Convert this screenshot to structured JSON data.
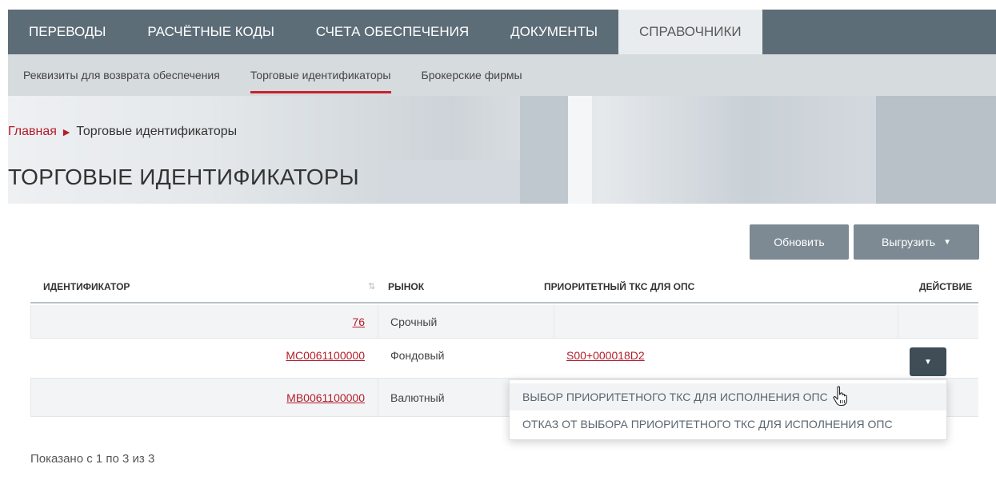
{
  "main_nav": [
    {
      "label": "ПЕРЕВОДЫ"
    },
    {
      "label": "РАСЧЁТНЫЕ КОДЫ"
    },
    {
      "label": "СЧЕТА ОБЕСПЕЧЕНИЯ"
    },
    {
      "label": "ДОКУМЕНТЫ"
    },
    {
      "label": "СПРАВОЧНИКИ",
      "active": true
    }
  ],
  "sub_nav": [
    {
      "label": "Реквизиты для возврата обеспечения"
    },
    {
      "label": "Торговые идентификаторы",
      "active": true
    },
    {
      "label": "Брокерские фирмы"
    }
  ],
  "breadcrumb": {
    "home": "Главная",
    "current": "Торговые идентификаторы"
  },
  "page_title": "ТОРГОВЫЕ ИДЕНТИФИКАТОРЫ",
  "toolbar": {
    "refresh_label": "Обновить",
    "export_label": "Выгрузить"
  },
  "table": {
    "headers": [
      "ИДЕНТИФИКАТОР",
      "РЫНОК",
      "ПРИОРИТЕТНЫЙ ТКС ДЛЯ ОПС",
      "ДЕЙСТВИЕ"
    ],
    "rows": [
      {
        "id": "76",
        "market": "Срочный",
        "tks": ""
      },
      {
        "id": "MC0061100000",
        "market": "Фондовый",
        "tks": "S00+000018D2"
      },
      {
        "id": "MB0061100000",
        "market": "Валютный",
        "tks": ""
      }
    ]
  },
  "action_menu": [
    "ВЫБОР ПРИОРИТЕТНОГО ТКС ДЛЯ ИСПОЛНЕНИЯ ОПС",
    "ОТКАЗ ОТ ВЫБОРА ПРИОРИТЕТНОГО ТКС ДЛЯ ИСПОЛНЕНИЯ ОПС"
  ],
  "pagination_info": "Показано с 1 по 3 из 3",
  "colors": {
    "accent": "#b31d2b",
    "nav_bg": "#5d6d78",
    "subnav_bg": "#d6dbde",
    "button_bg": "#7d8a93"
  }
}
